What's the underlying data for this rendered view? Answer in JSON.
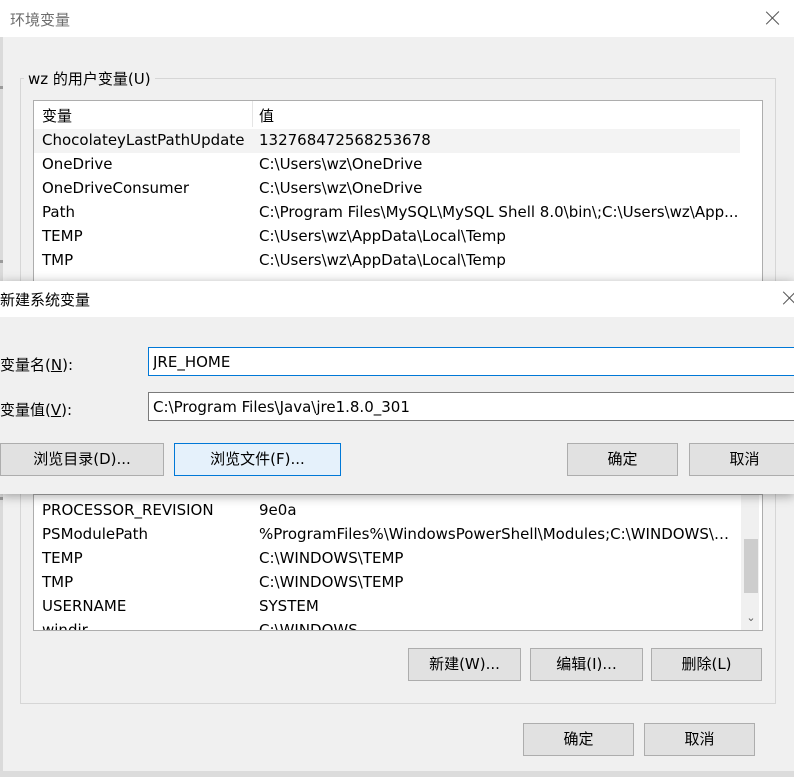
{
  "env_dialog": {
    "title": "环境变量",
    "user_group_label": "wz 的用户变量(U)",
    "columns": {
      "name": "变量",
      "value": "值"
    },
    "user_vars": [
      {
        "name": "ChocolateyLastPathUpdate",
        "value": "132768472568253678"
      },
      {
        "name": "OneDrive",
        "value": "C:\\Users\\wz\\OneDrive"
      },
      {
        "name": "OneDriveConsumer",
        "value": "C:\\Users\\wz\\OneDrive"
      },
      {
        "name": "Path",
        "value": "C:\\Program Files\\MySQL\\MySQL Shell 8.0\\bin\\;C:\\Users\\wz\\App..."
      },
      {
        "name": "TEMP",
        "value": "C:\\Users\\wz\\AppData\\Local\\Temp"
      },
      {
        "name": "TMP",
        "value": "C:\\Users\\wz\\AppData\\Local\\Temp"
      }
    ],
    "system_vars": [
      {
        "name": "PROCESSOR_REVISION",
        "value": "9e0a"
      },
      {
        "name": "PSModulePath",
        "value": "%ProgramFiles%\\WindowsPowerShell\\Modules;C:\\WINDOWS\\s..."
      },
      {
        "name": "TEMP",
        "value": "C:\\WINDOWS\\TEMP"
      },
      {
        "name": "TMP",
        "value": "C:\\WINDOWS\\TEMP"
      },
      {
        "name": "USERNAME",
        "value": "SYSTEM"
      },
      {
        "name": "windir",
        "value": "C:\\WINDOWS"
      }
    ],
    "system_buttons": {
      "new": "新建(W)...",
      "edit": "编辑(I)...",
      "delete": "删除(L)"
    },
    "ok": "确定",
    "cancel": "取消"
  },
  "new_var_dialog": {
    "title": "新建系统变量",
    "name_label_prefix": "变量名(",
    "name_label_key": "N",
    "name_label_suffix": "):",
    "value_label_prefix": "变量值(",
    "value_label_key": "V",
    "value_label_suffix": "):",
    "name_value": "JRE_HOME",
    "value_value": "C:\\Program Files\\Java\\jre1.8.0_301",
    "browse_dir": "浏览目录(D)...",
    "browse_file": "浏览文件(F)...",
    "ok": "确定",
    "cancel": "取消"
  },
  "colors": {
    "accent": "#0078d7",
    "focus_fill": "#e5f1fb",
    "button_fill": "#e1e1e1"
  },
  "icons": {
    "close": "close-icon",
    "scroll_down": "chevron-down-icon"
  }
}
